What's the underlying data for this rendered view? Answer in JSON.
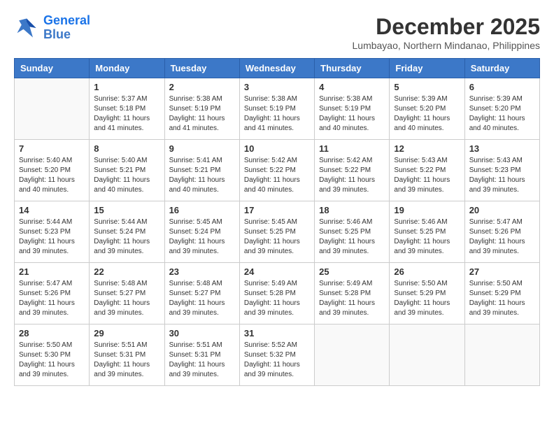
{
  "header": {
    "logo_line1": "General",
    "logo_line2": "Blue",
    "month": "December 2025",
    "location": "Lumbayao, Northern Mindanao, Philippines"
  },
  "days_of_week": [
    "Sunday",
    "Monday",
    "Tuesday",
    "Wednesday",
    "Thursday",
    "Friday",
    "Saturday"
  ],
  "weeks": [
    [
      {
        "day": "",
        "info": ""
      },
      {
        "day": "1",
        "info": "Sunrise: 5:37 AM\nSunset: 5:18 PM\nDaylight: 11 hours\nand 41 minutes."
      },
      {
        "day": "2",
        "info": "Sunrise: 5:38 AM\nSunset: 5:19 PM\nDaylight: 11 hours\nand 41 minutes."
      },
      {
        "day": "3",
        "info": "Sunrise: 5:38 AM\nSunset: 5:19 PM\nDaylight: 11 hours\nand 41 minutes."
      },
      {
        "day": "4",
        "info": "Sunrise: 5:38 AM\nSunset: 5:19 PM\nDaylight: 11 hours\nand 40 minutes."
      },
      {
        "day": "5",
        "info": "Sunrise: 5:39 AM\nSunset: 5:20 PM\nDaylight: 11 hours\nand 40 minutes."
      },
      {
        "day": "6",
        "info": "Sunrise: 5:39 AM\nSunset: 5:20 PM\nDaylight: 11 hours\nand 40 minutes."
      }
    ],
    [
      {
        "day": "7",
        "info": "Sunrise: 5:40 AM\nSunset: 5:20 PM\nDaylight: 11 hours\nand 40 minutes."
      },
      {
        "day": "8",
        "info": "Sunrise: 5:40 AM\nSunset: 5:21 PM\nDaylight: 11 hours\nand 40 minutes."
      },
      {
        "day": "9",
        "info": "Sunrise: 5:41 AM\nSunset: 5:21 PM\nDaylight: 11 hours\nand 40 minutes."
      },
      {
        "day": "10",
        "info": "Sunrise: 5:42 AM\nSunset: 5:22 PM\nDaylight: 11 hours\nand 40 minutes."
      },
      {
        "day": "11",
        "info": "Sunrise: 5:42 AM\nSunset: 5:22 PM\nDaylight: 11 hours\nand 39 minutes."
      },
      {
        "day": "12",
        "info": "Sunrise: 5:43 AM\nSunset: 5:22 PM\nDaylight: 11 hours\nand 39 minutes."
      },
      {
        "day": "13",
        "info": "Sunrise: 5:43 AM\nSunset: 5:23 PM\nDaylight: 11 hours\nand 39 minutes."
      }
    ],
    [
      {
        "day": "14",
        "info": "Sunrise: 5:44 AM\nSunset: 5:23 PM\nDaylight: 11 hours\nand 39 minutes."
      },
      {
        "day": "15",
        "info": "Sunrise: 5:44 AM\nSunset: 5:24 PM\nDaylight: 11 hours\nand 39 minutes."
      },
      {
        "day": "16",
        "info": "Sunrise: 5:45 AM\nSunset: 5:24 PM\nDaylight: 11 hours\nand 39 minutes."
      },
      {
        "day": "17",
        "info": "Sunrise: 5:45 AM\nSunset: 5:25 PM\nDaylight: 11 hours\nand 39 minutes."
      },
      {
        "day": "18",
        "info": "Sunrise: 5:46 AM\nSunset: 5:25 PM\nDaylight: 11 hours\nand 39 minutes."
      },
      {
        "day": "19",
        "info": "Sunrise: 5:46 AM\nSunset: 5:25 PM\nDaylight: 11 hours\nand 39 minutes."
      },
      {
        "day": "20",
        "info": "Sunrise: 5:47 AM\nSunset: 5:26 PM\nDaylight: 11 hours\nand 39 minutes."
      }
    ],
    [
      {
        "day": "21",
        "info": "Sunrise: 5:47 AM\nSunset: 5:26 PM\nDaylight: 11 hours\nand 39 minutes."
      },
      {
        "day": "22",
        "info": "Sunrise: 5:48 AM\nSunset: 5:27 PM\nDaylight: 11 hours\nand 39 minutes."
      },
      {
        "day": "23",
        "info": "Sunrise: 5:48 AM\nSunset: 5:27 PM\nDaylight: 11 hours\nand 39 minutes."
      },
      {
        "day": "24",
        "info": "Sunrise: 5:49 AM\nSunset: 5:28 PM\nDaylight: 11 hours\nand 39 minutes."
      },
      {
        "day": "25",
        "info": "Sunrise: 5:49 AM\nSunset: 5:28 PM\nDaylight: 11 hours\nand 39 minutes."
      },
      {
        "day": "26",
        "info": "Sunrise: 5:50 AM\nSunset: 5:29 PM\nDaylight: 11 hours\nand 39 minutes."
      },
      {
        "day": "27",
        "info": "Sunrise: 5:50 AM\nSunset: 5:29 PM\nDaylight: 11 hours\nand 39 minutes."
      }
    ],
    [
      {
        "day": "28",
        "info": "Sunrise: 5:50 AM\nSunset: 5:30 PM\nDaylight: 11 hours\nand 39 minutes."
      },
      {
        "day": "29",
        "info": "Sunrise: 5:51 AM\nSunset: 5:31 PM\nDaylight: 11 hours\nand 39 minutes."
      },
      {
        "day": "30",
        "info": "Sunrise: 5:51 AM\nSunset: 5:31 PM\nDaylight: 11 hours\nand 39 minutes."
      },
      {
        "day": "31",
        "info": "Sunrise: 5:52 AM\nSunset: 5:32 PM\nDaylight: 11 hours\nand 39 minutes."
      },
      {
        "day": "",
        "info": ""
      },
      {
        "day": "",
        "info": ""
      },
      {
        "day": "",
        "info": ""
      }
    ]
  ]
}
